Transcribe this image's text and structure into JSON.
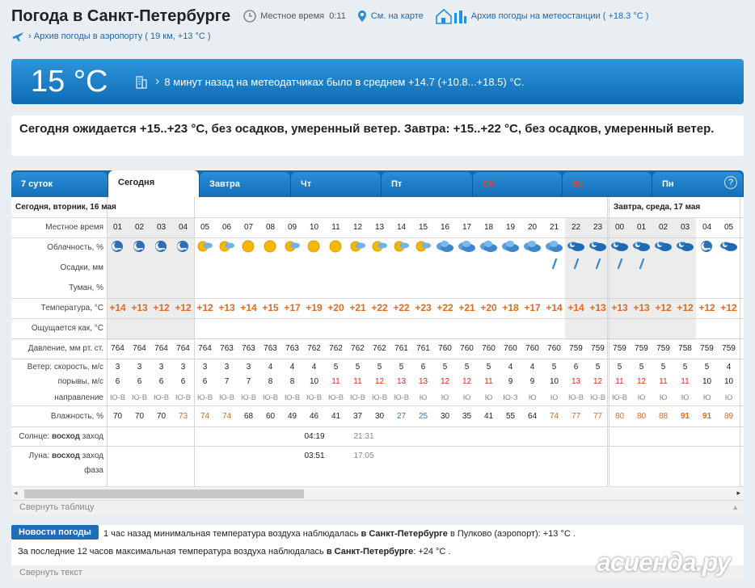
{
  "header": {
    "title": "Погода в Санкт-Петербурге",
    "local_time_label": "Местное время",
    "local_time": "0:11",
    "map_link": "См. на карте",
    "station_archive": "Архив погоды на метеостанции",
    "station_temp": "( +18.3 °C )",
    "airport_archive": "Архив погоды в аэропорту",
    "airport_info": "( 19 км, +13 °C )"
  },
  "banner": {
    "temp": "15 °C",
    "message": "8 минут назад на метеодатчиках было в среднем +14.7 (+10.8...+18.5) °C."
  },
  "forecast_text": "Сегодня ожидается +15..+23 °C, без осадков, умеренный ветер. Завтра: +15..+22 °C, без осадков, умеренный ветер.",
  "tabs": [
    "7 суток",
    "Сегодня",
    "Завтра",
    "Чт",
    "Пт",
    "Сб",
    "Вс",
    "Пн"
  ],
  "help_icon": "?",
  "table": {
    "day1_label": "Сегодня, вторник, 16 мая",
    "day2_label": "Завтра, среда, 17 мая",
    "row_labels": {
      "time": "Местное время",
      "clouds": "Облачность, %",
      "precip": "Осадки, мм",
      "fog": "Туман, %",
      "temp": "Температура, °C",
      "feels": "Ощущается как, °C",
      "pressure": "Давление, мм рт. ст.",
      "wind_speed": "Ветер: скорость, м/с",
      "gusts": "порывы, м/с",
      "direction": "направление",
      "humidity": "Влажность, %",
      "sun_prefix": "Солнце:",
      "sun_rise": "восход",
      "sun_set": "заход",
      "moon_prefix": "Луна:",
      "moon_rise": "восход",
      "moon_set": "заход",
      "moon_phase": "фаза"
    },
    "hours": [
      "01",
      "02",
      "03",
      "04",
      "05",
      "06",
      "07",
      "08",
      "09",
      "10",
      "11",
      "12",
      "13",
      "14",
      "15",
      "16",
      "17",
      "18",
      "19",
      "20",
      "21",
      "22",
      "23",
      "00",
      "01",
      "02",
      "03",
      "04",
      "05"
    ],
    "clouds": [
      "night",
      "night",
      "night",
      "night",
      "sun-cloud",
      "sun-cloud",
      "sun",
      "sun",
      "sun-cloud",
      "sun",
      "sun",
      "sun-cloud",
      "sun-cloud",
      "sun-cloud",
      "sun-cloud",
      "cloudy",
      "cloudy",
      "cloudy",
      "cloudy",
      "cloudy",
      "cloudy",
      "cloudy-night",
      "cloudy-night",
      "cloudy-night",
      "cloudy-night",
      "cloudy-night",
      "cloudy-night",
      "night",
      "cloudy-night"
    ],
    "rain": [
      false,
      false,
      false,
      false,
      false,
      false,
      false,
      false,
      false,
      false,
      false,
      false,
      false,
      false,
      false,
      false,
      false,
      false,
      false,
      false,
      true,
      true,
      true,
      true,
      true,
      false,
      false,
      false,
      false
    ],
    "temps": [
      "+14",
      "+13",
      "+12",
      "+12",
      "+12",
      "+13",
      "+14",
      "+15",
      "+17",
      "+19",
      "+20",
      "+21",
      "+22",
      "+22",
      "+23",
      "+22",
      "+21",
      "+20",
      "+18",
      "+17",
      "+14",
      "+14",
      "+13",
      "+13",
      "+13",
      "+12",
      "+12",
      "+12",
      "+12"
    ],
    "pressure": [
      "764",
      "764",
      "764",
      "764",
      "764",
      "763",
      "763",
      "763",
      "763",
      "762",
      "762",
      "762",
      "762",
      "761",
      "761",
      "760",
      "760",
      "760",
      "760",
      "760",
      "760",
      "759",
      "759",
      "759",
      "759",
      "759",
      "758",
      "759",
      "759"
    ],
    "wind": [
      "3",
      "3",
      "3",
      "3",
      "3",
      "3",
      "3",
      "4",
      "4",
      "4",
      "5",
      "5",
      "5",
      "5",
      "6",
      "5",
      "5",
      "5",
      "4",
      "4",
      "5",
      "6",
      "5",
      "5",
      "5",
      "5",
      "5",
      "5",
      "4"
    ],
    "gusts": [
      "6",
      "6",
      "6",
      "6",
      "6",
      "7",
      "7",
      "8",
      "8",
      "10",
      "11",
      "11",
      "12",
      "13",
      "13",
      "12",
      "12",
      "11",
      "9",
      "9",
      "10",
      "13",
      "12",
      "11",
      "12",
      "11",
      "11",
      "10",
      "10"
    ],
    "gust_red": [
      false,
      false,
      false,
      false,
      false,
      false,
      false,
      false,
      false,
      false,
      true,
      true,
      true,
      true,
      true,
      true,
      true,
      true,
      false,
      false,
      false,
      true,
      true,
      true,
      true,
      true,
      true,
      false,
      false
    ],
    "direction": [
      "Ю-В",
      "Ю-В",
      "Ю-В",
      "Ю-В",
      "Ю-В",
      "Ю-В",
      "Ю-В",
      "Ю-В",
      "Ю-В",
      "Ю-В",
      "Ю-В",
      "Ю-В",
      "Ю-В",
      "Ю-В",
      "Ю",
      "Ю",
      "Ю",
      "Ю",
      "Ю-З",
      "Ю",
      "Ю",
      "Ю-В",
      "Ю-В",
      "Ю-В",
      "Ю",
      "Ю",
      "Ю",
      "Ю",
      "Ю"
    ],
    "humidity": [
      "70",
      "70",
      "70",
      "73",
      "74",
      "74",
      "68",
      "60",
      "49",
      "46",
      "41",
      "37",
      "30",
      "27",
      "25",
      "30",
      "35",
      "41",
      "55",
      "64",
      "74",
      "77",
      "77",
      "80",
      "80",
      "88",
      "91",
      "91",
      "89"
    ],
    "humidity_style": [
      "",
      "",
      "",
      "o",
      "o",
      "o",
      "",
      "",
      "",
      "",
      "",
      "",
      "",
      "b",
      "b",
      "",
      "",
      "",
      "",
      "",
      "o",
      "o",
      "o",
      "o",
      "o",
      "o",
      "ob",
      "ob",
      "o"
    ],
    "sunrise": "04:19",
    "sunset": "21:31",
    "moonrise": "03:51",
    "moonset": "17:05"
  },
  "collapse_table": "Свернуть таблицу",
  "news": {
    "tag": "Новости погоды",
    "line1_a": "1 час назад минимальная температура воздуха наблюдалась",
    "line1_b": "в Санкт-Петербурге",
    "line1_c": "в Пулково (аэропорт): +13 °C .",
    "line2_a": "За последние 12 часов максимальная температура воздуха наблюдалась",
    "line2_b": "в Санкт-Петербурге",
    "line2_c": ": +24 °C ."
  },
  "collapse_text": "Свернуть текст",
  "watermark": "асиенда.ру",
  "colors": {
    "accent": "#0e6cb5",
    "temp": "#e06b1f",
    "red": "#d62a1a"
  }
}
